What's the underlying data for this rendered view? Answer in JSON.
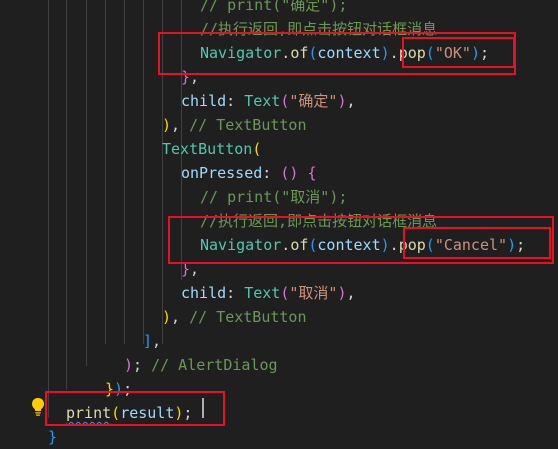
{
  "editor": {
    "lines": [
      {
        "tokens": [
          {
            "t": "// print(\"确定\");",
            "c": "comment"
          }
        ]
      },
      {
        "tokens": [
          {
            "t": "//执行返回,即点击按钮对话框消息",
            "c": "comment"
          }
        ]
      },
      {
        "tokens": [
          {
            "t": "Navigator",
            "c": "class"
          },
          {
            "t": ".",
            "c": "punc"
          },
          {
            "t": "of",
            "c": "fn"
          },
          {
            "t": "(",
            "c": "b3"
          },
          {
            "t": "context",
            "c": "prop"
          },
          {
            "t": ")",
            "c": "b3"
          },
          {
            "t": ".",
            "c": "punc"
          },
          {
            "t": "pop",
            "c": "fn"
          },
          {
            "t": "(",
            "c": "b3"
          },
          {
            "t": "\"OK\"",
            "c": "str"
          },
          {
            "t": ")",
            "c": "b3"
          },
          {
            "t": ";",
            "c": "punc"
          }
        ]
      },
      {
        "tokens": [
          {
            "t": "}",
            "c": "b2"
          },
          {
            "t": ",",
            "c": "punc"
          }
        ]
      },
      {
        "tokens": [
          {
            "t": "child",
            "c": "prop"
          },
          {
            "t": ": ",
            "c": "punc"
          },
          {
            "t": "Text",
            "c": "class"
          },
          {
            "t": "(",
            "c": "b2"
          },
          {
            "t": "\"确定\"",
            "c": "str"
          },
          {
            "t": ")",
            "c": "b2"
          },
          {
            "t": ",",
            "c": "punc"
          }
        ]
      },
      {
        "tokens": [
          {
            "t": ")",
            "c": "b1"
          },
          {
            "t": ", ",
            "c": "punc"
          },
          {
            "t": "// TextButton",
            "c": "comment"
          }
        ]
      },
      {
        "tokens": [
          {
            "t": "TextButton",
            "c": "class"
          },
          {
            "t": "(",
            "c": "b1"
          }
        ]
      },
      {
        "tokens": [
          {
            "t": "onPressed",
            "c": "prop"
          },
          {
            "t": ": ",
            "c": "punc"
          },
          {
            "t": "()",
            "c": "b2"
          },
          {
            "t": " ",
            "c": "punc"
          },
          {
            "t": "{",
            "c": "b2"
          }
        ]
      },
      {
        "tokens": [
          {
            "t": "// print(\"取消\");",
            "c": "comment"
          }
        ]
      },
      {
        "tokens": [
          {
            "t": "//执行返回,即点击按钮对话框消息",
            "c": "comment"
          }
        ]
      },
      {
        "tokens": [
          {
            "t": "Navigator",
            "c": "class"
          },
          {
            "t": ".",
            "c": "punc"
          },
          {
            "t": "of",
            "c": "fn"
          },
          {
            "t": "(",
            "c": "b3"
          },
          {
            "t": "context",
            "c": "prop"
          },
          {
            "t": ")",
            "c": "b3"
          },
          {
            "t": ".",
            "c": "punc"
          },
          {
            "t": "pop",
            "c": "fn"
          },
          {
            "t": "(",
            "c": "b3"
          },
          {
            "t": "\"Cancel\"",
            "c": "str"
          },
          {
            "t": ")",
            "c": "b3"
          },
          {
            "t": ";",
            "c": "punc"
          }
        ]
      },
      {
        "tokens": [
          {
            "t": "}",
            "c": "b2"
          },
          {
            "t": ",",
            "c": "punc"
          }
        ]
      },
      {
        "tokens": [
          {
            "t": "child",
            "c": "prop"
          },
          {
            "t": ": ",
            "c": "punc"
          },
          {
            "t": "Text",
            "c": "class"
          },
          {
            "t": "(",
            "c": "b2"
          },
          {
            "t": "\"取消\"",
            "c": "str"
          },
          {
            "t": ")",
            "c": "b2"
          },
          {
            "t": ",",
            "c": "punc"
          }
        ]
      },
      {
        "tokens": [
          {
            "t": ")",
            "c": "b1"
          },
          {
            "t": ", ",
            "c": "punc"
          },
          {
            "t": "// TextButton",
            "c": "comment"
          }
        ]
      },
      {
        "tokens": [
          {
            "t": "]",
            "c": "b3"
          },
          {
            "t": ",",
            "c": "punc"
          }
        ]
      },
      {
        "tokens": [
          {
            "t": ")",
            "c": "b2"
          },
          {
            "t": "; ",
            "c": "punc"
          },
          {
            "t": "// AlertDialog",
            "c": "comment"
          }
        ]
      },
      {
        "tokens": [
          {
            "t": "}",
            "c": "b1"
          },
          {
            "t": ")",
            "c": "b3"
          },
          {
            "t": ";",
            "c": "punc"
          }
        ]
      },
      {
        "tokens": [
          {
            "t": "print",
            "c": "fn",
            "squiggle": true
          },
          {
            "t": "(",
            "c": "b1"
          },
          {
            "t": "result",
            "c": "prop"
          },
          {
            "t": ")",
            "c": "b1"
          },
          {
            "t": ";",
            "c": "punc"
          }
        ]
      },
      {
        "tokens": [
          {
            "t": "}",
            "c": "b3"
          }
        ]
      }
    ],
    "lightbulb_icon": "lightbulb-icon",
    "colors": {
      "background": "#1f1f1f",
      "annotation": "#e81123",
      "lightbulb": "#ffcc00"
    }
  }
}
